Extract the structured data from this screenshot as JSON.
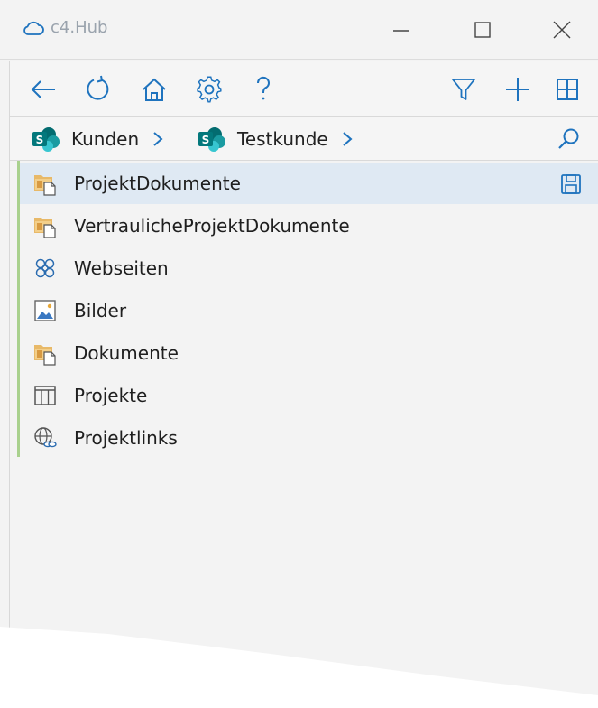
{
  "window": {
    "title": "c4.Hub",
    "app_icon": "cloud-icon",
    "controls": [
      "minimize-icon",
      "maximize-icon",
      "close-icon"
    ]
  },
  "toolbar": {
    "left": [
      "back-arrow-icon",
      "refresh-icon",
      "home-icon",
      "settings-gear-icon",
      "help-icon"
    ],
    "right": [
      "filter-icon",
      "add-icon",
      "grid-view-icon"
    ],
    "accent_color": "#1e73be"
  },
  "breadcrumb": {
    "items": [
      {
        "label": "Kunden",
        "icon": "sharepoint-icon"
      },
      {
        "label": "Testkunde",
        "icon": "sharepoint-icon"
      }
    ],
    "search_icon": "search-icon"
  },
  "list": {
    "items": [
      {
        "label": "ProjektDokumente",
        "icon": "document-library-icon",
        "selected": true
      },
      {
        "label": "VertraulicheProjektDokumente",
        "icon": "document-library-icon",
        "selected": false
      },
      {
        "label": "Webseiten",
        "icon": "webpages-icon",
        "selected": false
      },
      {
        "label": "Bilder",
        "icon": "picture-library-icon",
        "selected": false
      },
      {
        "label": "Dokumente",
        "icon": "document-library-icon",
        "selected": false
      },
      {
        "label": "Projekte",
        "icon": "list-table-icon",
        "selected": false
      },
      {
        "label": "Projektlinks",
        "icon": "links-globe-icon",
        "selected": false
      }
    ],
    "selected_action_icon": "save-icon",
    "selected_color": "#dfe9f3",
    "accent_bar_color": "#a9d18e"
  }
}
